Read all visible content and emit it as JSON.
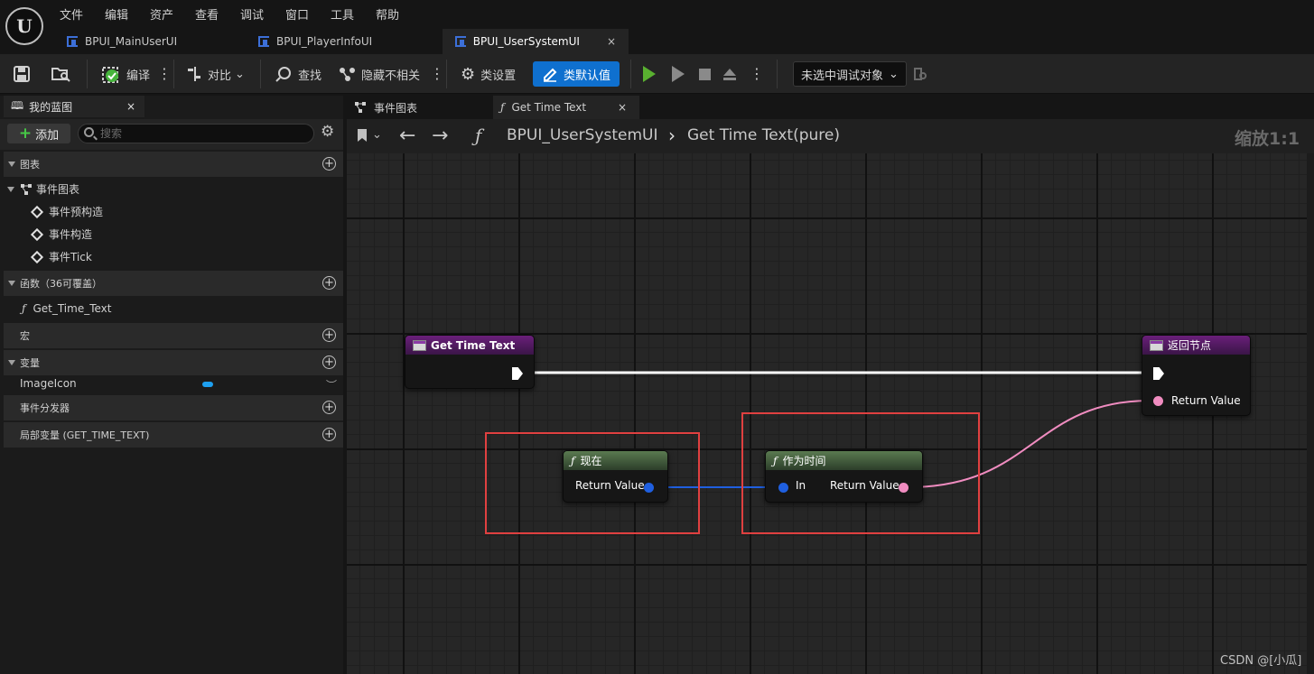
{
  "menu": [
    "文件",
    "编辑",
    "资产",
    "查看",
    "调试",
    "窗口",
    "工具",
    "帮助"
  ],
  "tabs": [
    {
      "label": "BPUI_MainUserUI"
    },
    {
      "label": "BPUI_PlayerInfoUI"
    },
    {
      "label": "BPUI_UserSystemUI",
      "close": "×"
    }
  ],
  "toolbar": {
    "compile": "编译",
    "diff": "对比",
    "find": "查找",
    "hide_unrelated": "隐藏不相关",
    "class_settings": "类设置",
    "class_defaults": "类默认值",
    "debug_object": "未选中调试对象"
  },
  "left_panel": {
    "title": "我的蓝图",
    "close": "×",
    "add": "添加",
    "search_placeholder": "搜索",
    "graphs_header": "图表",
    "event_graph": "事件图表",
    "events": [
      "事件预构造",
      "事件构造",
      "事件Tick"
    ],
    "functions_header": "函数（36可覆盖）",
    "function_item": "Get_Time_Text",
    "macros_header": "宏",
    "variables_header": "变量",
    "variable_item": "ImageIcon",
    "dispatchers_header": "事件分发器",
    "local_vars_header": "局部变量 (GET_TIME_TEXT)"
  },
  "graph_tabs": {
    "event_graph": "事件图表",
    "function": "Get Time Text",
    "close": "×"
  },
  "breadcrumb": {
    "blueprint": "BPUI_UserSystemUI",
    "separator": "›",
    "function": "Get Time Text(pure)",
    "zoom": "缩放1:1"
  },
  "nodes": {
    "entry": {
      "title": "Get Time Text"
    },
    "return": {
      "title": "返回节点",
      "pin": "Return Value"
    },
    "now": {
      "title": "现在",
      "pin": "Return Value"
    },
    "as_time": {
      "title": "作为时间",
      "pin_in": "In",
      "pin_out": "Return Value"
    }
  },
  "colors": {
    "function_header": "#6a1f7a",
    "pure_header": "#5a7a50",
    "datetime_wire": "#1f5fe0",
    "text_wire": "#f08cc0",
    "exec_wire": "#ffffff",
    "highlight": "#e04040",
    "accent": "#0f70cf"
  },
  "watermark": "CSDN @[小瓜]"
}
